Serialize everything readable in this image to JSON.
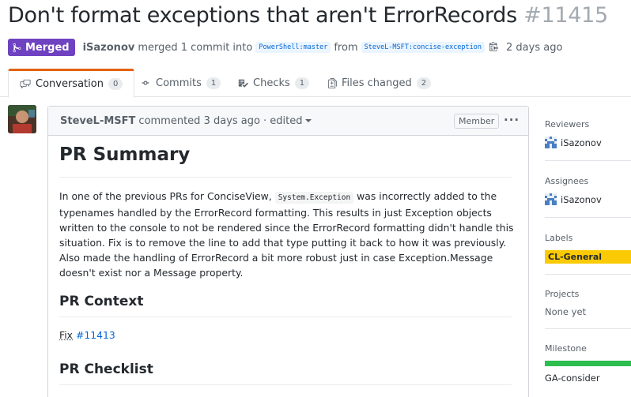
{
  "pr": {
    "title": "Don't format exceptions that aren't ErrorRecords",
    "number": "#11415",
    "status": "Merged",
    "author": "iSazonov",
    "merge_text": "merged 1 commit into",
    "base_branch": "PowerShell:master",
    "from_text": "from",
    "head_branch": "SteveL-MSFT:concise-exception",
    "time": "2 days ago"
  },
  "tabs": [
    {
      "label": "Conversation",
      "count": "0",
      "icon": "comment-discussion-icon"
    },
    {
      "label": "Commits",
      "count": "1",
      "icon": "git-commit-icon"
    },
    {
      "label": "Checks",
      "count": "1",
      "icon": "checklist-icon"
    },
    {
      "label": "Files changed",
      "count": "2",
      "icon": "file-diff-icon"
    }
  ],
  "comment": {
    "author": "SteveL-MSFT",
    "action": "commented 3 days ago",
    "edited": "· edited",
    "role_badge": "Member",
    "more": "···",
    "heading": "PR Summary",
    "summary_pre": "In one of the previous PRs for ConciseView,",
    "summary_code": "System.Exception",
    "summary_post": "was incorrectly added to the typenames handled by the ErrorRecord formatting. This results in just Exception objects written to the console to not be rendered since the ErrorRecord formatting didn't handle this situation. Fix is to remove the line to add that type putting it back to how it was previously. Also made the handling of ErrorRecord a bit more robust just in case Exception.Message doesn't exist nor a Message property.",
    "context_heading": "PR Context",
    "fix_word": "Fix",
    "fix_link": "#11413",
    "checklist_heading": "PR Checklist"
  },
  "sidebar": {
    "reviewers_label": "Reviewers",
    "reviewer": "iSazonov",
    "assignees_label": "Assignees",
    "assignee": "iSazonov",
    "labels_label": "Labels",
    "label": "CL-General",
    "label_color": "#fbca04",
    "projects_label": "Projects",
    "projects_value": "None yet",
    "milestone_label": "Milestone",
    "milestone_progress": 1.0,
    "milestone_value": "GA-consider"
  },
  "colors": {
    "merged": "#6f42c1",
    "link": "#0366d6",
    "tab_accent": "#e36209",
    "milestone_bar": "#2cbe4e"
  }
}
